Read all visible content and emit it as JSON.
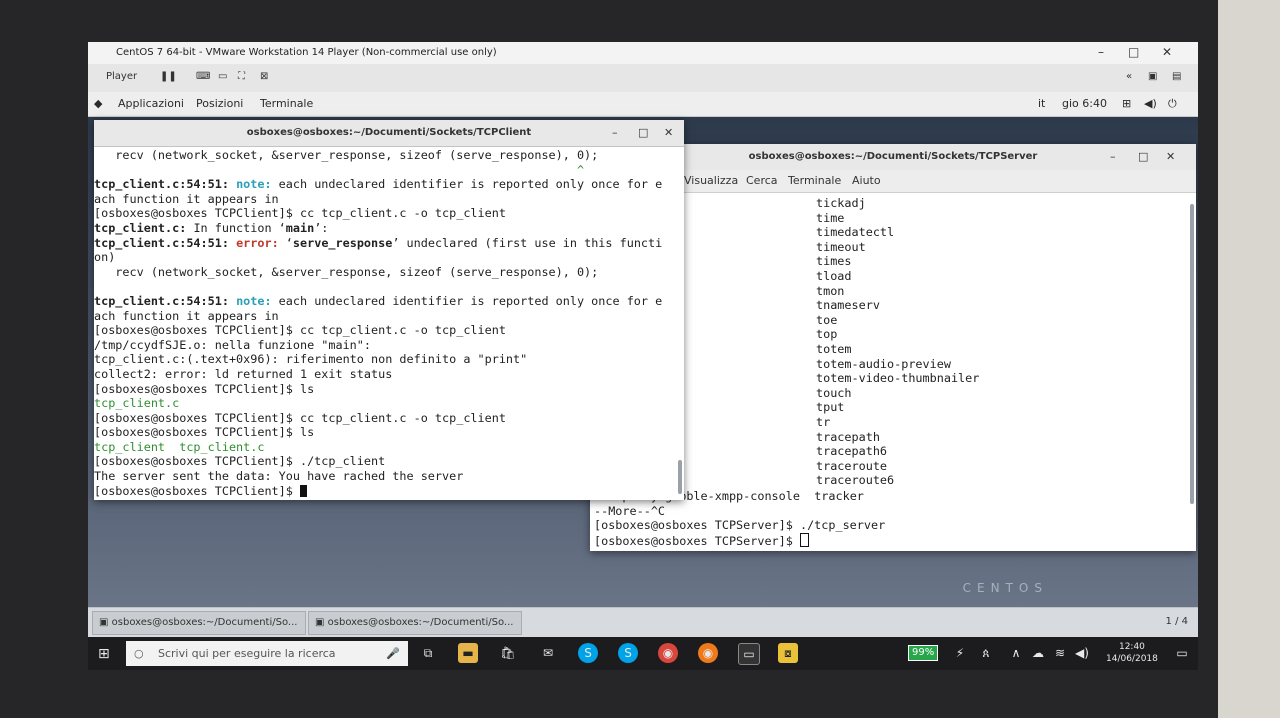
{
  "vmware": {
    "title": "CentOS 7 64-bit - VMware Workstation 14 Player (Non-commercial use only)",
    "player_menu": "Player",
    "min": "–",
    "max": "□",
    "close": "✕"
  },
  "gnome": {
    "menu": [
      "Applicazioni",
      "Posizioni",
      "Terminale"
    ],
    "locale": "it",
    "clock": "gio 6:40"
  },
  "client_window": {
    "title": "osboxes@osboxes:~/Documenti/Sockets/TCPClient"
  },
  "server_window": {
    "title": "osboxes@osboxes:~/Documenti/Sockets/TCPServer",
    "menu": [
      "Visualizza",
      "Cerca",
      "Terminale",
      "Aiuto"
    ],
    "list": [
      "tickadj",
      "time",
      "timedatectl",
      "timeout",
      "times",
      "tload",
      "tmon",
      "tnameserv",
      "toe",
      "top",
      "totem",
      "totem-audio-preview",
      "totem-video-thumbnailer",
      "touch",
      "tput",
      "tr",
      "tracepath",
      "tracepath6",
      "traceroute",
      "traceroute6"
    ],
    "partial_line_left": "telepathy-gabble-xmpp-console",
    "partial_line_right": "tracker",
    "more": "--More--^C",
    "cmd1": "[osboxes@osboxes TCPServer]$ ./tcp_server",
    "prompt": "[osboxes@osboxes TCPServer]$ "
  },
  "desktop": {
    "brand": "CENTOS"
  },
  "taskstrip": {
    "tabs": [
      "osboxes@osboxes:~/Documenti/So...",
      "osboxes@osboxes:~/Documenti/So..."
    ],
    "pager": "1 / 4"
  },
  "windows": {
    "search_placeholder": "Scrivi qui per eseguire la ricerca",
    "battery": "99%",
    "time": "12:40",
    "date": "14/06/2018"
  }
}
